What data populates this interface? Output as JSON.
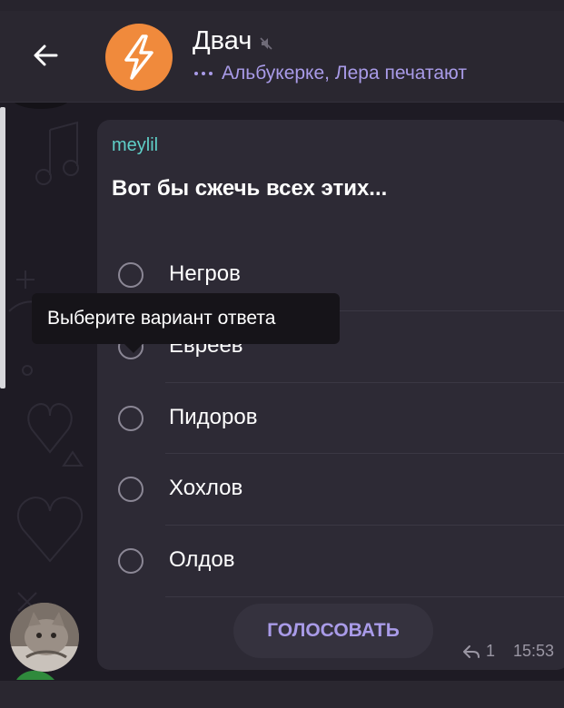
{
  "header": {
    "back_icon": "arrow-left-icon",
    "avatar_icon": "lightning-bolt-icon",
    "avatar_color": "#f08a3c",
    "title": "Двач",
    "mute_icon": "muted-speaker-icon",
    "status": "Альбукерке, Лера печатают",
    "status_color": "#a99be8"
  },
  "message": {
    "sender": "meylil",
    "sender_color": "#5fcfc8",
    "question": "Вот бы сжечь всех этих...",
    "tooltip": "Выберите вариант ответа",
    "options": [
      {
        "label": "Негров"
      },
      {
        "label": "Евреев"
      },
      {
        "label": "Пидоров"
      },
      {
        "label": "Хохлов"
      },
      {
        "label": "Олдов"
      }
    ],
    "vote_label": "ГОЛОСОВАТЬ",
    "reply_icon": "reply-arrow-icon",
    "reply_count": "1",
    "time": "15:53"
  }
}
